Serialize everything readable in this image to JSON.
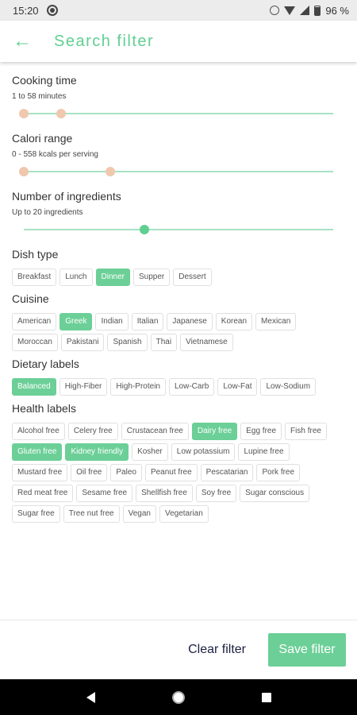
{
  "status": {
    "time": "15:20",
    "battery": "96 %"
  },
  "header": {
    "back_icon": "arrow-left-icon",
    "title": "Search filter"
  },
  "cooking_time": {
    "label": "Cooking time",
    "range_text": "1 to 58 minutes",
    "min": 1,
    "max": 58,
    "low_fraction": 0.0,
    "high_fraction": 0.12
  },
  "calori_range": {
    "label": "Calori range",
    "range_text": "0 - 558 kcals per serving",
    "min": 0,
    "max": 558,
    "low_fraction": 0.0,
    "high_fraction": 0.28
  },
  "ingredients": {
    "label": "Number of ingredients",
    "range_text": "Up to 20 ingredients",
    "value": 20,
    "fraction": 0.39
  },
  "dish_type": {
    "label": "Dish type",
    "options": [
      {
        "label": "Breakfast",
        "selected": false
      },
      {
        "label": "Lunch",
        "selected": false
      },
      {
        "label": "Dinner",
        "selected": true
      },
      {
        "label": "Supper",
        "selected": false
      },
      {
        "label": "Dessert",
        "selected": false
      }
    ]
  },
  "cuisine": {
    "label": "Cuisine",
    "options": [
      {
        "label": "American",
        "selected": false
      },
      {
        "label": "Greek",
        "selected": true
      },
      {
        "label": "Indian",
        "selected": false
      },
      {
        "label": "Italian",
        "selected": false
      },
      {
        "label": "Japanese",
        "selected": false
      },
      {
        "label": "Korean",
        "selected": false
      },
      {
        "label": "Mexican",
        "selected": false
      },
      {
        "label": "Moroccan",
        "selected": false
      },
      {
        "label": "Pakistani",
        "selected": false
      },
      {
        "label": "Spanish",
        "selected": false
      },
      {
        "label": "Thai",
        "selected": false
      },
      {
        "label": "Vietnamese",
        "selected": false
      }
    ]
  },
  "dietary": {
    "label": "Dietary labels",
    "options": [
      {
        "label": "Balanced",
        "selected": true
      },
      {
        "label": "High-Fiber",
        "selected": false
      },
      {
        "label": "High-Protein",
        "selected": false
      },
      {
        "label": "Low-Carb",
        "selected": false
      },
      {
        "label": "Low-Fat",
        "selected": false
      },
      {
        "label": "Low-Sodium",
        "selected": false
      }
    ]
  },
  "health": {
    "label": "Health labels",
    "options": [
      {
        "label": "Alcohol free",
        "selected": false
      },
      {
        "label": "Celery free",
        "selected": false
      },
      {
        "label": "Crustacean free",
        "selected": false
      },
      {
        "label": "Dairy free",
        "selected": true
      },
      {
        "label": "Egg free",
        "selected": false
      },
      {
        "label": "Fish free",
        "selected": false
      },
      {
        "label": "Gluten free",
        "selected": true
      },
      {
        "label": "Kidney friendly",
        "selected": true
      },
      {
        "label": "Kosher",
        "selected": false
      },
      {
        "label": "Low potassium",
        "selected": false
      },
      {
        "label": "Lupine free",
        "selected": false
      },
      {
        "label": "Mustard free",
        "selected": false
      },
      {
        "label": "Oil free",
        "selected": false
      },
      {
        "label": "Paleo",
        "selected": false
      },
      {
        "label": "Peanut free",
        "selected": false
      },
      {
        "label": "Pescatarian",
        "selected": false
      },
      {
        "label": "Pork free",
        "selected": false
      },
      {
        "label": "Red meat free",
        "selected": false
      },
      {
        "label": "Sesame free",
        "selected": false
      },
      {
        "label": "Shellfish free",
        "selected": false
      },
      {
        "label": "Soy free",
        "selected": false
      },
      {
        "label": "Sugar conscious",
        "selected": false
      },
      {
        "label": "Sugar free",
        "selected": false
      },
      {
        "label": "Tree nut free",
        "selected": false
      },
      {
        "label": "Vegan",
        "selected": false
      },
      {
        "label": "Vegetarian",
        "selected": false
      }
    ]
  },
  "footer": {
    "clear_label": "Clear filter",
    "save_label": "Save filter"
  },
  "colors": {
    "accent": "#5fcf92",
    "chip_selected": "#6ccf97",
    "track": "#a8e2c3",
    "knob_peach": "#f0c8ae",
    "button_text_dark": "#1c2040"
  }
}
